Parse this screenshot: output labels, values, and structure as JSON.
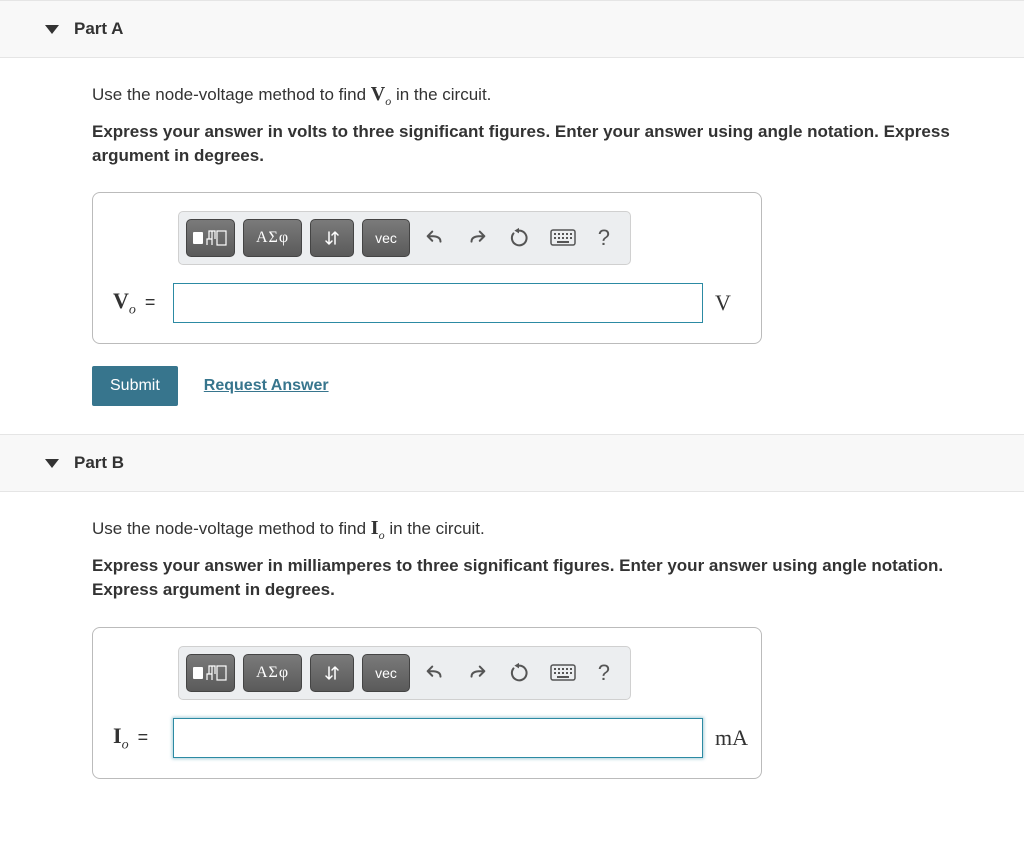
{
  "partA": {
    "title": "Part A",
    "prompt_pre": "Use the node-voltage method to find ",
    "prompt_var": "V",
    "prompt_sub": "o",
    "prompt_post": " in the circuit.",
    "instruction": "Express your answer in volts to three significant figures. Enter your answer using angle notation. Express argument in degrees.",
    "var_symbol": "V",
    "var_sub": "o",
    "unit": "V",
    "submit": "Submit",
    "request": "Request Answer"
  },
  "partB": {
    "title": "Part B",
    "prompt_pre": "Use the node-voltage method to find ",
    "prompt_var": "I",
    "prompt_sub": "o",
    "prompt_post": " in the circuit.",
    "instruction": "Express your answer in milliamperes to three significant figures. Enter your answer using angle notation. Express argument in degrees.",
    "var_symbol": "I",
    "var_sub": "o",
    "unit": "mA"
  },
  "toolbar": {
    "greek": "ΑΣφ",
    "vec": "vec",
    "help": "?"
  }
}
